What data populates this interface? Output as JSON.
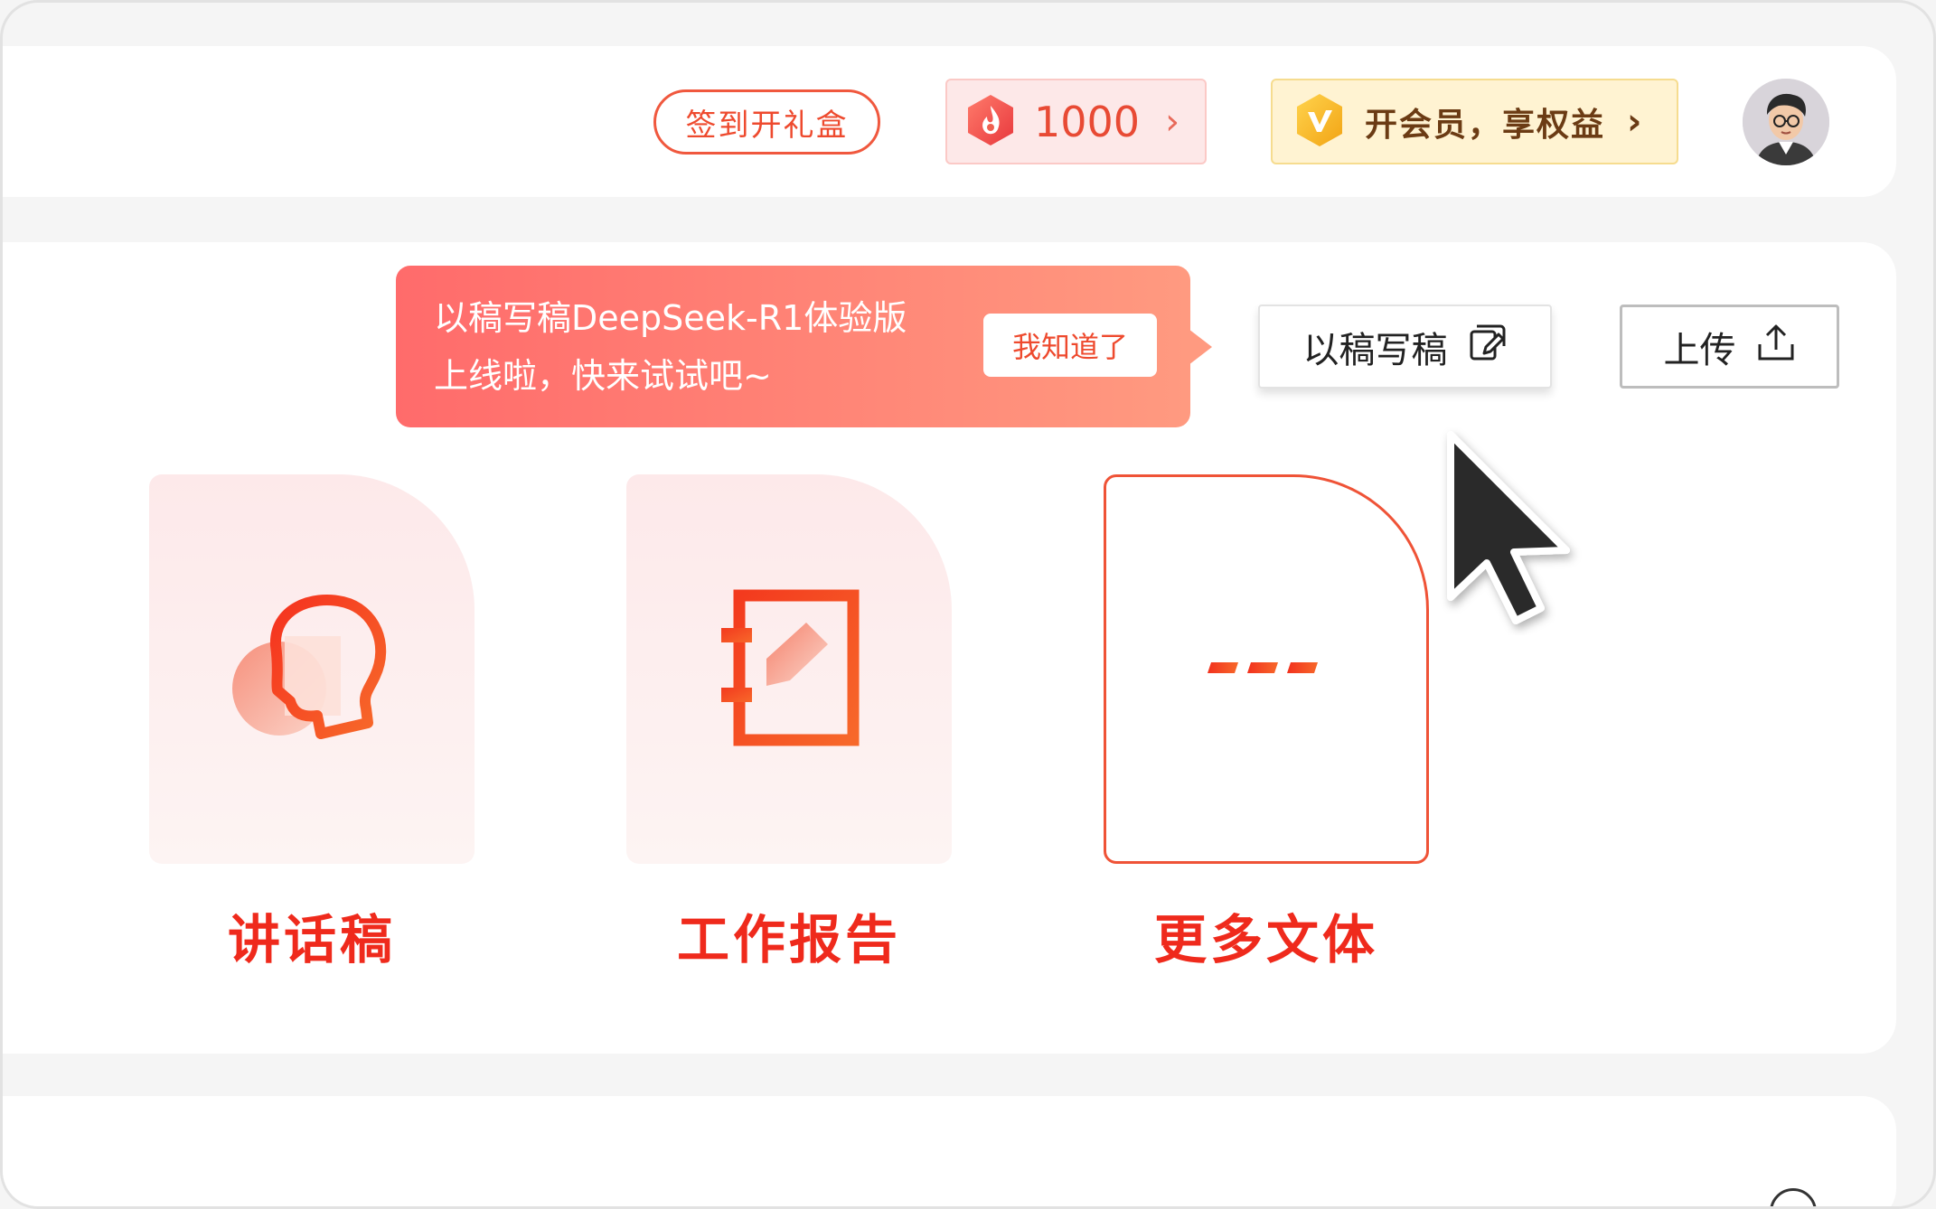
{
  "header": {
    "checkin_label": "签到开礼盒",
    "points_value": "1000",
    "vip_label": "开会员，享权益",
    "icons": {
      "points": "flame-coin-icon",
      "vip": "vip-badge-icon",
      "chevron": "chevron-right-icon",
      "avatar": "user-avatar"
    }
  },
  "tooltip": {
    "line1": "以稿写稿DeepSeek-R1体验版",
    "line2": "上线啦，快来试试吧~",
    "dismiss_label": "我知道了"
  },
  "toolbar": {
    "write_from_draft_label": "以稿写稿",
    "upload_label": "上传"
  },
  "cards": [
    {
      "label": "讲话稿",
      "icon": "speech-head-icon"
    },
    {
      "label": "工作报告",
      "icon": "notebook-pen-icon"
    },
    {
      "label": "更多文体",
      "icon": "dashes-more-icon"
    }
  ],
  "colors": {
    "accent": "#ef2a1c",
    "accent_soft": "#ff6b6b",
    "vip_text": "#6b3b14",
    "card_bg": "#fde9ea"
  }
}
